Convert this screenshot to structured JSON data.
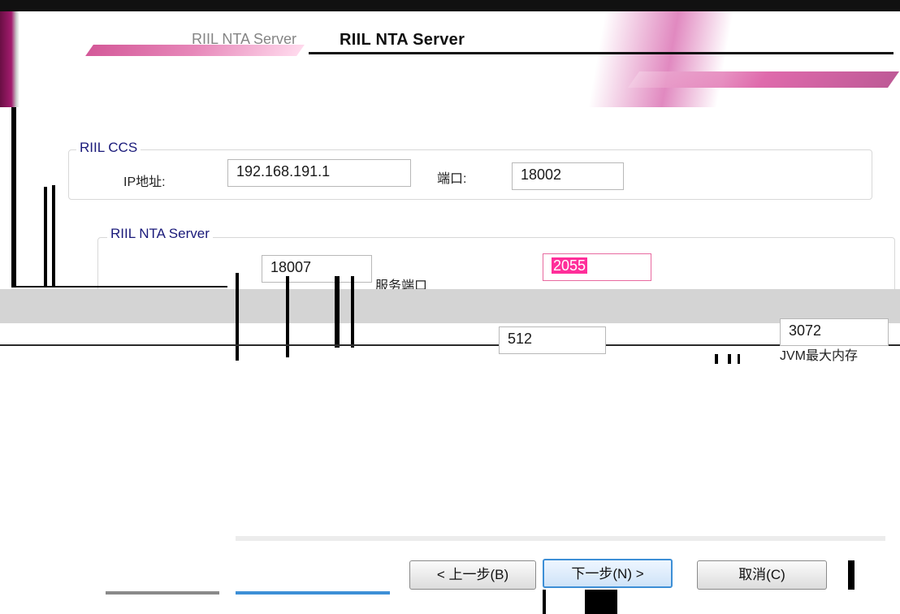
{
  "window": {
    "title": "RIIL NTA Server",
    "subtitle": ""
  },
  "header": {
    "title": "RIIL NTA Server"
  },
  "ccs": {
    "legend": "RIIL CCS",
    "ip_label": "IP地址:",
    "ip_value": "192.168.191.1",
    "port_label": "端口:",
    "port_value": "18002"
  },
  "nta": {
    "legend": "RIIL NTA Server",
    "service_port_value": "18007",
    "collector_port_label": "服务端口",
    "collector_port_value": "2055",
    "memory_value": "512",
    "jvm_value": "3072",
    "jvm_label": "JVM最大内存"
  },
  "buttons": {
    "back": "< 上一步(B)",
    "next": "下一步(N) >",
    "cancel": "取消(C)"
  }
}
